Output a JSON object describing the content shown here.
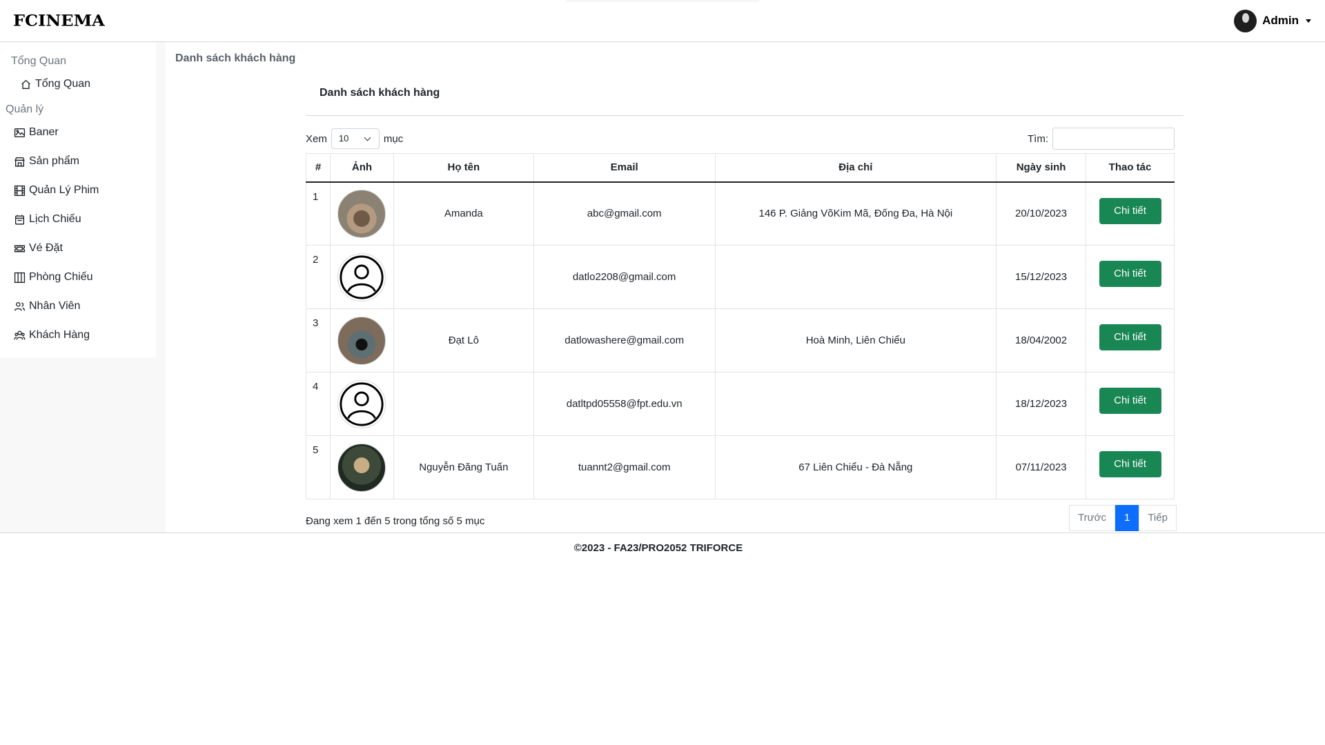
{
  "app": {
    "brand": "FCINEMA",
    "user": "Admin"
  },
  "sidebar": {
    "section_overview": "Tổng Quan",
    "overview_item": "Tổng Quan",
    "section_manage": "Quản lý",
    "items": [
      {
        "label": "Baner",
        "icon": "banner-icon"
      },
      {
        "label": "Sản phẩm",
        "icon": "shop-icon"
      },
      {
        "label": "Quản Lý Phim",
        "icon": "film-icon"
      },
      {
        "label": "Lịch Chiếu",
        "icon": "calendar-icon"
      },
      {
        "label": "Vé Đặt",
        "icon": "ticket-icon"
      },
      {
        "label": "Phòng Chiếu",
        "icon": "columns-icon"
      },
      {
        "label": "Nhân Viên",
        "icon": "people-icon"
      },
      {
        "label": "Khách Hàng",
        "icon": "people-icon"
      }
    ]
  },
  "page": {
    "breadcrumb": "Danh sách khách hàng",
    "card_title": "Danh sách khách hàng",
    "length_prefix": "Xem",
    "length_value": "10",
    "length_suffix": "mục",
    "search_label": "Tìm:",
    "search_value": ""
  },
  "table": {
    "headers": [
      "#",
      "Ảnh",
      "Họ tên",
      "Email",
      "Địa chỉ",
      "Ngày sinh",
      "Thao tác"
    ],
    "rows": [
      {
        "num": "1",
        "name": "Amanda",
        "email": "abc@gmail.com",
        "address": "146 P. Giảng VõKim Mã, Đống Đa, Hà Nội",
        "dob": "20/10/2023",
        "action": "Chi tiết"
      },
      {
        "num": "2",
        "name": "",
        "email": "datlo2208@gmail.com",
        "address": "",
        "dob": "15/12/2023",
        "action": "Chi tiết"
      },
      {
        "num": "3",
        "name": "Đạt Lô",
        "email": "datlowashere@gmail.com",
        "address": "Hoà Minh, Liên Chiểu",
        "dob": "18/04/2002",
        "action": "Chi tiết"
      },
      {
        "num": "4",
        "name": "",
        "email": "datltpd05558@fpt.edu.vn",
        "address": "",
        "dob": "18/12/2023",
        "action": "Chi tiết"
      },
      {
        "num": "5",
        "name": "Nguyễn Đăng Tuấn",
        "email": "tuannt2@gmail.com",
        "address": "67 Liên Chiểu - Đà Nẵng",
        "dob": "07/11/2023",
        "action": "Chi tiết"
      }
    ]
  },
  "footer_info": {
    "text": "Đang xem 1 đến 5 trong tổng số 5 mục",
    "prev": "Trước",
    "page": "1",
    "next": "Tiếp"
  },
  "footer": "©2023 - FA23/PRO2052 TRIFORCE",
  "colors": {
    "accent": "#0d6efd",
    "success": "#198754",
    "sidebar_bg": "#f8f8f8"
  }
}
